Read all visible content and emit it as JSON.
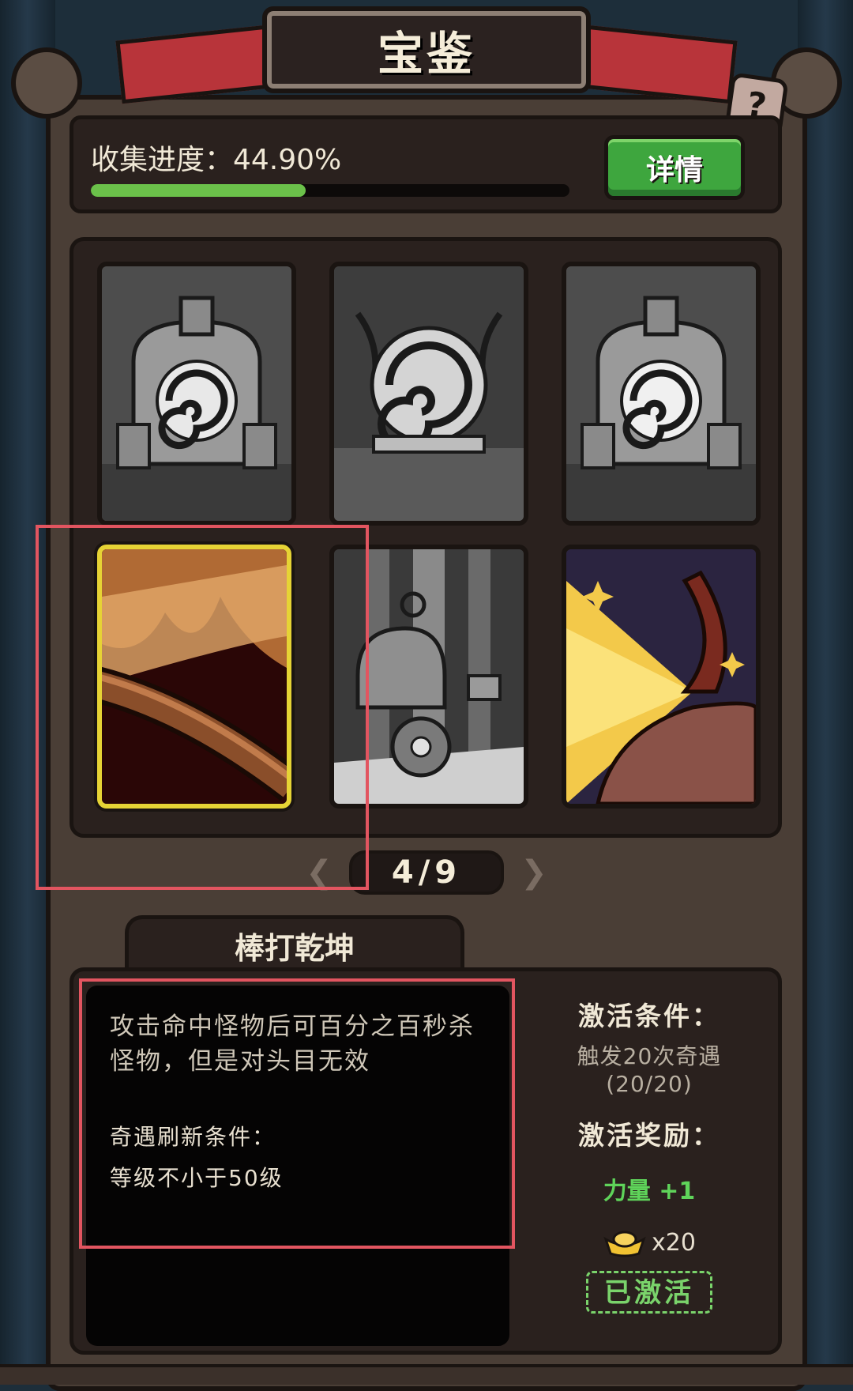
{
  "header": {
    "title": "宝鉴",
    "help_label": "?"
  },
  "progress": {
    "label": "收集进度：44.90%",
    "value_percent": 44.9,
    "detail_button": "详情"
  },
  "cards": [
    {
      "name": "portal-card-1",
      "state": "locked"
    },
    {
      "name": "vortex-orb-card",
      "state": "locked"
    },
    {
      "name": "portal-card-2",
      "state": "locked"
    },
    {
      "name": "staff-card",
      "state": "selected"
    },
    {
      "name": "helmet-coins-card",
      "state": "locked"
    },
    {
      "name": "hand-light-card",
      "state": "unlocked"
    }
  ],
  "pager": {
    "text": "4/9",
    "prev_icon": "chevron-left-icon",
    "next_icon": "chevron-right-icon"
  },
  "detail": {
    "name": "棒打乾坤",
    "description": "攻击命中怪物后可百分之百秒杀怪物，但是对头目无效",
    "refresh_title": "奇遇刷新条件：",
    "refresh_value": "等级不小于50级",
    "activate_condition_title": "激活条件：",
    "activate_condition_text": "触发20次奇遇",
    "activate_condition_progress": "(20/20)",
    "reward_title": "激活奖励：",
    "reward_stat": "力量 +1",
    "reward_ingot_count": "x20",
    "status_button": "已激活"
  },
  "colors": {
    "accent_green": "#3ea63e",
    "selection_yellow": "#e6d335",
    "highlight_red": "#e25560"
  }
}
